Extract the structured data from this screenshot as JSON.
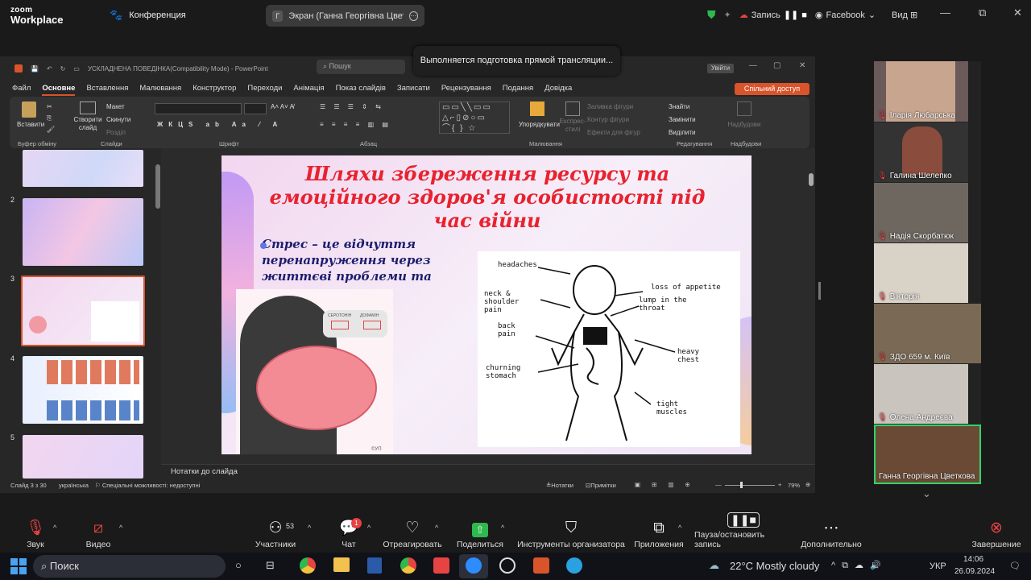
{
  "zoom": {
    "logo_top": "zoom",
    "logo_bottom": "Workplace",
    "meeting_label": "Конференция",
    "share_pill_initial": "Г",
    "share_pill_label": "Экран (Ганна Георгівна Цветко",
    "record_label": "Запись",
    "live_label": "Facebook",
    "view_label": "Вид",
    "toast": "Выполняется подготовка прямой трансляции..."
  },
  "powerpoint": {
    "doc_title": "УСКЛАДНЕНА ПОВЕДІНКА(Compatibility Mode)  -  PowerPoint",
    "search_placeholder": "Пошук",
    "sign_in": "Увійти",
    "menu": [
      "Файл",
      "Основне",
      "Вставлення",
      "Малювання",
      "Конструктор",
      "Переходи",
      "Анімація",
      "Показ слайдів",
      "Записати",
      "Рецензування",
      "Подання",
      "Довідка"
    ],
    "share_button": "Спільний доступ",
    "ribbon": {
      "paste": "Вставити",
      "new_slide": "Створити слайд",
      "layout": "Макет",
      "reset": "Скинути",
      "section": "Розділ",
      "group_clipboard": "Буфер обміну",
      "group_slides": "Слайди",
      "group_font": "Шрифт",
      "group_paragraph": "Абзац",
      "group_drawing": "Малювання",
      "group_editing": "Редагування",
      "group_addins": "Надбудови",
      "arrange": "Упорядкувати",
      "quick_styles": "Експрес-стилі",
      "shape_fill": "Заливка фігури",
      "shape_outline": "Контур фігури",
      "shape_effects": "Ефекти для фігур",
      "find": "Знайти",
      "replace": "Замінити",
      "select": "Виділити",
      "addins": "Надбудови"
    },
    "thumb_numbers": [
      "2",
      "3",
      "4",
      "5"
    ],
    "slide": {
      "title": "Шляхи збереження ресурсу та емоційного здоров'я особистості під час війни",
      "body": "Стрес – це відчуття перенапруження через життєві проблеми та загрози",
      "serotonin": "СЕРОТОНІН",
      "dopamine": "ДОФАМІН",
      "credit": "©УП",
      "labels": [
        "headaches",
        "neck & shoulder pain",
        "loss of appetite",
        "lump in the throat",
        "back pain",
        "heavy chest",
        "churning stomach",
        "tight muscles"
      ]
    },
    "notes": "Нотатки до слайда",
    "status_slide": "Слайд 3 з 30",
    "status_lang": "українська",
    "status_access": "Спеціальні можливості: недоступні",
    "status_notes": "Нотатки",
    "status_comments": "Примітки",
    "zoom_level": "79%"
  },
  "participants": [
    "Іларія Любарська",
    "Галина Шелепко",
    "Надія Скорбатюк",
    "Вікторія",
    "ЗДО 659 м. Київ",
    "Олена Андреєва",
    "Ганна Георгівна Цветкова"
  ],
  "toolbar": {
    "audio": "Звук",
    "video": "Видео",
    "participants": "Участники",
    "participants_count": "53",
    "chat": "Чат",
    "chat_badge": "1",
    "react": "Отреагировать",
    "share": "Поделиться",
    "host_tools": "Инструменты организатора",
    "apps": "Приложения",
    "pause_record": "Пауза/остановить запись",
    "more": "Дополнительно",
    "end": "Завершение"
  },
  "taskbar": {
    "search": "Поиск",
    "weather": "22°C  Mostly cloudy",
    "lang": "УКР",
    "time": "14:06",
    "date": "26.09.2024"
  }
}
